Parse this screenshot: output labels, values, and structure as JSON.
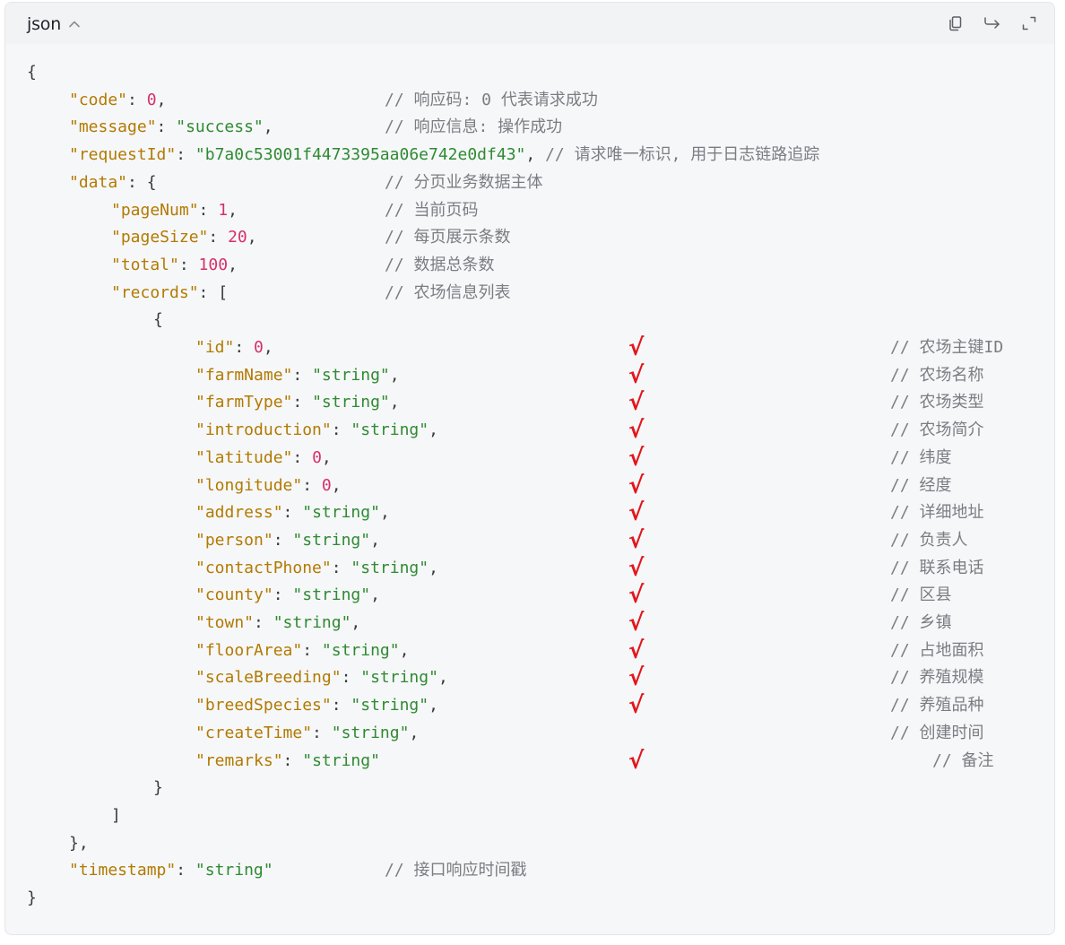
{
  "header": {
    "language_label": "json",
    "toggle_icon": "chevron-up-icon",
    "actions": [
      {
        "name": "copy-button",
        "icon": "copy-icon"
      },
      {
        "name": "wrap-button",
        "icon": "wrap-icon"
      },
      {
        "name": "expand-button",
        "icon": "expand-icon"
      }
    ]
  },
  "colors": {
    "key": "#b27a00",
    "string": "#2f8a32",
    "number": "#d6306d",
    "comment": "#7a7d82",
    "punctuation": "#3a3a3a",
    "checkmark": "#e3161b",
    "background": "#f6f7f9",
    "header_background": "#f2f3f5"
  },
  "code": {
    "lines": [
      {
        "indent": 0,
        "tokens": [
          {
            "t": "punc",
            "v": "{"
          }
        ]
      },
      {
        "indent": 1,
        "tokens": [
          {
            "t": "key",
            "v": "\"code\""
          },
          {
            "t": "punc",
            "v": ": "
          },
          {
            "t": "num",
            "v": "0"
          },
          {
            "t": "punc",
            "v": ","
          }
        ],
        "comment": "// 响应码: 0 代表请求成功",
        "comment_col": 8
      },
      {
        "indent": 1,
        "tokens": [
          {
            "t": "key",
            "v": "\"message\""
          },
          {
            "t": "punc",
            "v": ": "
          },
          {
            "t": "str",
            "v": "\"success\""
          },
          {
            "t": "punc",
            "v": ","
          }
        ],
        "comment": "// 响应信息: 操作成功",
        "comment_col": 8
      },
      {
        "indent": 1,
        "tokens": [
          {
            "t": "key",
            "v": "\"requestId\""
          },
          {
            "t": "punc",
            "v": ": "
          },
          {
            "t": "str",
            "v": "\"b7a0c53001f4473395aa06e742e0df43\""
          },
          {
            "t": "punc",
            "v": ", "
          }
        ],
        "comment": "// 请求唯一标识, 用于日志链路追踪",
        "comment_col": 8,
        "comment_inline": true
      },
      {
        "indent": 1,
        "tokens": [
          {
            "t": "key",
            "v": "\"data\""
          },
          {
            "t": "punc",
            "v": ": {"
          }
        ],
        "comment": "// 分页业务数据主体",
        "comment_col": 8
      },
      {
        "indent": 2,
        "tokens": [
          {
            "t": "key",
            "v": "\"pageNum\""
          },
          {
            "t": "punc",
            "v": ": "
          },
          {
            "t": "num",
            "v": "1"
          },
          {
            "t": "punc",
            "v": ","
          }
        ],
        "comment": "// 当前页码",
        "comment_col": 8
      },
      {
        "indent": 2,
        "tokens": [
          {
            "t": "key",
            "v": "\"pageSize\""
          },
          {
            "t": "punc",
            "v": ": "
          },
          {
            "t": "num",
            "v": "20"
          },
          {
            "t": "punc",
            "v": ","
          }
        ],
        "comment": "// 每页展示条数",
        "comment_col": 8
      },
      {
        "indent": 2,
        "tokens": [
          {
            "t": "key",
            "v": "\"total\""
          },
          {
            "t": "punc",
            "v": ": "
          },
          {
            "t": "num",
            "v": "100"
          },
          {
            "t": "punc",
            "v": ","
          }
        ],
        "comment": "// 数据总条数",
        "comment_col": 8
      },
      {
        "indent": 2,
        "tokens": [
          {
            "t": "key",
            "v": "\"records\""
          },
          {
            "t": "punc",
            "v": ": ["
          }
        ],
        "comment": "// 农场信息列表",
        "comment_col": 8
      },
      {
        "indent": 3,
        "tokens": [
          {
            "t": "punc",
            "v": "{"
          }
        ]
      },
      {
        "indent": 4,
        "tokens": [
          {
            "t": "key",
            "v": "\"id\""
          },
          {
            "t": "punc",
            "v": ": "
          },
          {
            "t": "num",
            "v": "0"
          },
          {
            "t": "punc",
            "v": ","
          }
        ],
        "comment": "// 农场主键ID",
        "comment_col": 20,
        "check": "√"
      },
      {
        "indent": 4,
        "tokens": [
          {
            "t": "key",
            "v": "\"farmName\""
          },
          {
            "t": "punc",
            "v": ": "
          },
          {
            "t": "str",
            "v": "\"string\""
          },
          {
            "t": "punc",
            "v": ","
          }
        ],
        "comment": "// 农场名称",
        "comment_col": 20,
        "check": "√"
      },
      {
        "indent": 4,
        "tokens": [
          {
            "t": "key",
            "v": "\"farmType\""
          },
          {
            "t": "punc",
            "v": ": "
          },
          {
            "t": "str",
            "v": "\"string\""
          },
          {
            "t": "punc",
            "v": ","
          }
        ],
        "comment": "// 农场类型",
        "comment_col": 20,
        "check": "√"
      },
      {
        "indent": 4,
        "tokens": [
          {
            "t": "key",
            "v": "\"introduction\""
          },
          {
            "t": "punc",
            "v": ": "
          },
          {
            "t": "str",
            "v": "\"string\""
          },
          {
            "t": "punc",
            "v": ","
          }
        ],
        "comment": "// 农场简介",
        "comment_col": 20,
        "check": "√"
      },
      {
        "indent": 4,
        "tokens": [
          {
            "t": "key",
            "v": "\"latitude\""
          },
          {
            "t": "punc",
            "v": ": "
          },
          {
            "t": "num",
            "v": "0"
          },
          {
            "t": "punc",
            "v": ","
          }
        ],
        "comment": "// 纬度",
        "comment_col": 20,
        "check": "√"
      },
      {
        "indent": 4,
        "tokens": [
          {
            "t": "key",
            "v": "\"longitude\""
          },
          {
            "t": "punc",
            "v": ": "
          },
          {
            "t": "num",
            "v": "0"
          },
          {
            "t": "punc",
            "v": ","
          }
        ],
        "comment": "// 经度",
        "comment_col": 20,
        "check": "√"
      },
      {
        "indent": 4,
        "tokens": [
          {
            "t": "key",
            "v": "\"address\""
          },
          {
            "t": "punc",
            "v": ": "
          },
          {
            "t": "str",
            "v": "\"string\""
          },
          {
            "t": "punc",
            "v": ","
          }
        ],
        "comment": "// 详细地址",
        "comment_col": 20,
        "check": "√"
      },
      {
        "indent": 4,
        "tokens": [
          {
            "t": "key",
            "v": "\"person\""
          },
          {
            "t": "punc",
            "v": ": "
          },
          {
            "t": "str",
            "v": "\"string\""
          },
          {
            "t": "punc",
            "v": ","
          }
        ],
        "comment": "// 负责人",
        "comment_col": 20,
        "check": "√"
      },
      {
        "indent": 4,
        "tokens": [
          {
            "t": "key",
            "v": "\"contactPhone\""
          },
          {
            "t": "punc",
            "v": ": "
          },
          {
            "t": "str",
            "v": "\"string\""
          },
          {
            "t": "punc",
            "v": ","
          }
        ],
        "comment": "// 联系电话",
        "comment_col": 20,
        "check": "√"
      },
      {
        "indent": 4,
        "tokens": [
          {
            "t": "key",
            "v": "\"county\""
          },
          {
            "t": "punc",
            "v": ": "
          },
          {
            "t": "str",
            "v": "\"string\""
          },
          {
            "t": "punc",
            "v": ","
          }
        ],
        "comment": "// 区县",
        "comment_col": 20,
        "check": "√"
      },
      {
        "indent": 4,
        "tokens": [
          {
            "t": "key",
            "v": "\"town\""
          },
          {
            "t": "punc",
            "v": ": "
          },
          {
            "t": "str",
            "v": "\"string\""
          },
          {
            "t": "punc",
            "v": ","
          }
        ],
        "comment": "// 乡镇",
        "comment_col": 20,
        "check": "√"
      },
      {
        "indent": 4,
        "tokens": [
          {
            "t": "key",
            "v": "\"floorArea\""
          },
          {
            "t": "punc",
            "v": ": "
          },
          {
            "t": "str",
            "v": "\"string\""
          },
          {
            "t": "punc",
            "v": ","
          }
        ],
        "comment": "// 占地面积",
        "comment_col": 20,
        "check": "√"
      },
      {
        "indent": 4,
        "tokens": [
          {
            "t": "key",
            "v": "\"scaleBreeding\""
          },
          {
            "t": "punc",
            "v": ": "
          },
          {
            "t": "str",
            "v": "\"string\""
          },
          {
            "t": "punc",
            "v": ","
          }
        ],
        "comment": "// 养殖规模",
        "comment_col": 20,
        "check": "√"
      },
      {
        "indent": 4,
        "tokens": [
          {
            "t": "key",
            "v": "\"breedSpecies\""
          },
          {
            "t": "punc",
            "v": ": "
          },
          {
            "t": "str",
            "v": "\"string\""
          },
          {
            "t": "punc",
            "v": ","
          }
        ],
        "comment": "// 养殖品种",
        "comment_col": 20,
        "check": "√"
      },
      {
        "indent": 4,
        "tokens": [
          {
            "t": "key",
            "v": "\"createTime\""
          },
          {
            "t": "punc",
            "v": ": "
          },
          {
            "t": "str",
            "v": "\"string\""
          },
          {
            "t": "punc",
            "v": ","
          }
        ],
        "comment": "// 创建时间",
        "comment_col": 20
      },
      {
        "indent": 4,
        "tokens": [
          {
            "t": "key",
            "v": "\"remarks\""
          },
          {
            "t": "punc",
            "v": ": "
          },
          {
            "t": "str",
            "v": "\"string\""
          }
        ],
        "comment": "// 备注",
        "comment_col": 21,
        "check": "√"
      },
      {
        "indent": 3,
        "tokens": [
          {
            "t": "punc",
            "v": "}"
          }
        ]
      },
      {
        "indent": 2,
        "tokens": [
          {
            "t": "punc",
            "v": "]"
          }
        ]
      },
      {
        "indent": 1,
        "tokens": [
          {
            "t": "punc",
            "v": "},"
          }
        ]
      },
      {
        "indent": 1,
        "tokens": [
          {
            "t": "key",
            "v": "\"timestamp\""
          },
          {
            "t": "punc",
            "v": ": "
          },
          {
            "t": "str",
            "v": "\"string\""
          }
        ],
        "comment": "// 接口响应时间戳",
        "comment_col": 8
      },
      {
        "indent": 0,
        "tokens": [
          {
            "t": "punc",
            "v": "}"
          }
        ]
      }
    ]
  }
}
